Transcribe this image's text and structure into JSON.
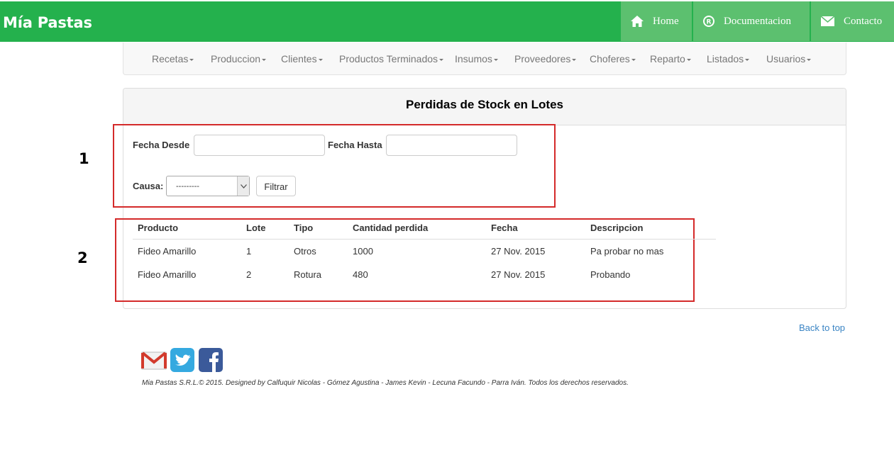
{
  "header": {
    "brand": "Mía Pastas",
    "nav": [
      {
        "label": "Home",
        "icon": "home-icon"
      },
      {
        "label": "Documentacion",
        "icon": "registered-icon"
      },
      {
        "label": "Contacto",
        "icon": "envelope-icon"
      }
    ]
  },
  "main_nav": [
    "Recetas",
    "Produccion",
    "Clientes",
    "Productos Terminados",
    "Insumos",
    "Proveedores",
    "Choferes",
    "Reparto",
    "Listados",
    "Usuarios"
  ],
  "panel": {
    "title": "Perdidas de Stock en Lotes"
  },
  "filters": {
    "fecha_desde_label": "Fecha Desde",
    "fecha_desde_value": "",
    "fecha_hasta_label": "Fecha Hasta",
    "fecha_hasta_value": "",
    "causa_label": "Causa:",
    "causa_selected": "---------",
    "filter_button": "Filtrar"
  },
  "annotations": [
    "1",
    "2"
  ],
  "table": {
    "columns": [
      "Producto",
      "Lote",
      "Tipo",
      "Cantidad perdida",
      "Fecha",
      "Descripcion"
    ],
    "rows": [
      [
        "Fideo Amarillo",
        "1",
        "Otros",
        "1000",
        "27 Nov. 2015",
        "Pa probar no mas"
      ],
      [
        "Fideo Amarillo",
        "2",
        "Rotura",
        "480",
        "27 Nov. 2015",
        "Probando"
      ]
    ]
  },
  "footer": {
    "back_to_top": "Back to top",
    "social": [
      "gmail-icon",
      "twitter-icon",
      "facebook-icon"
    ],
    "copyright": "Mia Pastas S.R.L.© 2015. Designed by Calfuquir Nicolas - Gómez Agustina - James Kevin - Lecuna Facundo - Parra Iván. Todos los derechos reservados."
  },
  "colors": {
    "header_green": "#24b14d",
    "nav_item_green": "#5cc06f",
    "annotation_red": "#d42a2a",
    "link_blue": "#3a84c4"
  }
}
